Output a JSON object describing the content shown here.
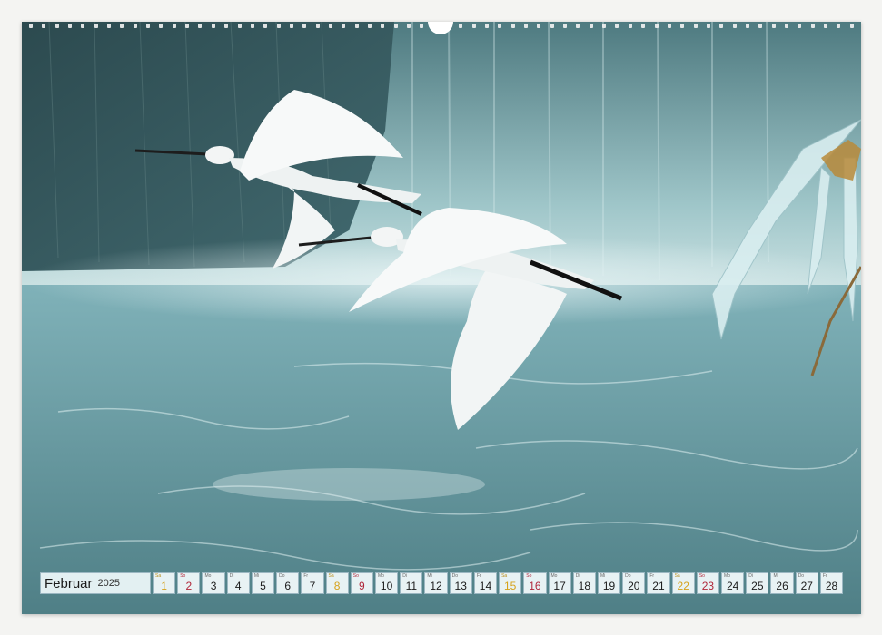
{
  "colors": {
    "sky_water": "#8fbcc4",
    "saturday": "#d6a21a",
    "sunday": "#b0273a"
  },
  "calendar": {
    "month": "Februar",
    "year": "2025",
    "days": [
      {
        "wd": "Sa",
        "num": "1",
        "kind": "sat"
      },
      {
        "wd": "So",
        "num": "2",
        "kind": "sun"
      },
      {
        "wd": "Mo",
        "num": "3",
        "kind": ""
      },
      {
        "wd": "Di",
        "num": "4",
        "kind": ""
      },
      {
        "wd": "Mi",
        "num": "5",
        "kind": ""
      },
      {
        "wd": "Do",
        "num": "6",
        "kind": ""
      },
      {
        "wd": "Fr",
        "num": "7",
        "kind": ""
      },
      {
        "wd": "Sa",
        "num": "8",
        "kind": "sat"
      },
      {
        "wd": "So",
        "num": "9",
        "kind": "sun"
      },
      {
        "wd": "Mo",
        "num": "10",
        "kind": ""
      },
      {
        "wd": "Di",
        "num": "11",
        "kind": ""
      },
      {
        "wd": "Mi",
        "num": "12",
        "kind": ""
      },
      {
        "wd": "Do",
        "num": "13",
        "kind": ""
      },
      {
        "wd": "Fr",
        "num": "14",
        "kind": ""
      },
      {
        "wd": "Sa",
        "num": "15",
        "kind": "sat"
      },
      {
        "wd": "So",
        "num": "16",
        "kind": "sun"
      },
      {
        "wd": "Mo",
        "num": "17",
        "kind": ""
      },
      {
        "wd": "Di",
        "num": "18",
        "kind": ""
      },
      {
        "wd": "Mi",
        "num": "19",
        "kind": ""
      },
      {
        "wd": "Do",
        "num": "20",
        "kind": ""
      },
      {
        "wd": "Fr",
        "num": "21",
        "kind": ""
      },
      {
        "wd": "Sa",
        "num": "22",
        "kind": "sat"
      },
      {
        "wd": "So",
        "num": "23",
        "kind": "sun"
      },
      {
        "wd": "Mo",
        "num": "24",
        "kind": ""
      },
      {
        "wd": "Di",
        "num": "25",
        "kind": ""
      },
      {
        "wd": "Mi",
        "num": "26",
        "kind": ""
      },
      {
        "wd": "Do",
        "num": "27",
        "kind": ""
      },
      {
        "wd": "Fr",
        "num": "28",
        "kind": ""
      }
    ]
  }
}
